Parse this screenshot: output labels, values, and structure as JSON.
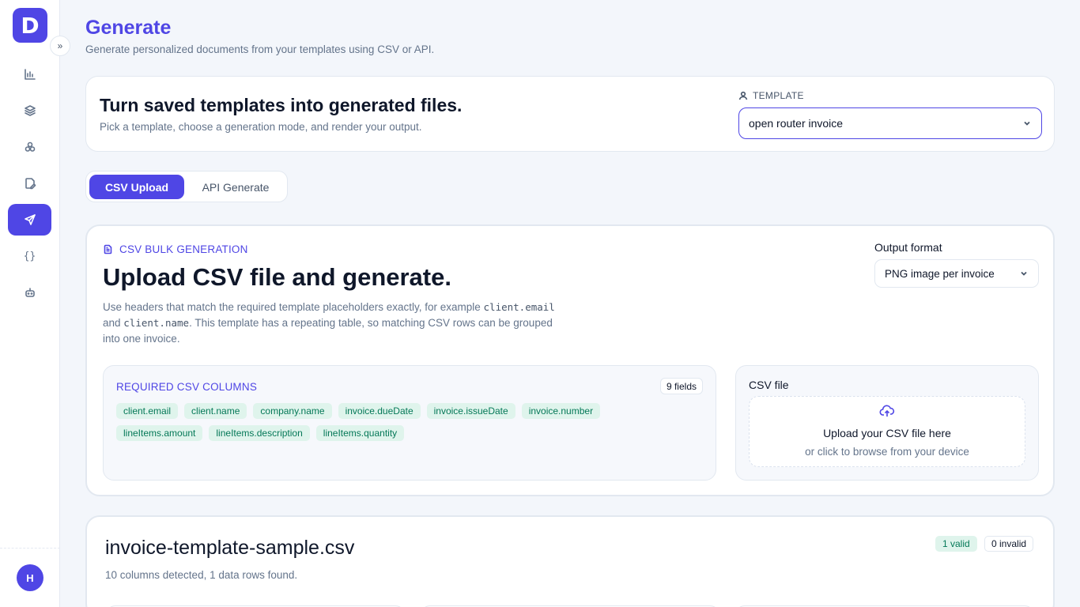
{
  "sidebar": {
    "logo_letter": "D",
    "collapse_icon": "chevrons-right-icon",
    "items": [
      {
        "name": "analytics",
        "icon": "bar-chart-icon"
      },
      {
        "name": "layers",
        "icon": "layers-icon"
      },
      {
        "name": "components",
        "icon": "boxes-icon"
      },
      {
        "name": "editor",
        "icon": "file-edit-icon"
      },
      {
        "name": "generate",
        "icon": "send-icon",
        "active": true
      },
      {
        "name": "api",
        "icon": "braces-icon",
        "glyph": "{}"
      },
      {
        "name": "bot",
        "icon": "bot-icon"
      }
    ],
    "avatar_initial": "H"
  },
  "header": {
    "title": "Generate",
    "subtitle": "Generate personalized documents from your templates using CSV or API."
  },
  "template_card": {
    "heading": "Turn saved templates into generated files.",
    "subheading": "Pick a template, choose a generation mode, and render your output.",
    "label": "TEMPLATE",
    "selected": "open router invoice"
  },
  "tabs": [
    {
      "label": "CSV Upload",
      "active": true
    },
    {
      "label": "API Generate",
      "active": false
    }
  ],
  "csv_card": {
    "kicker": "CSV BULK GENERATION",
    "heading": "Upload CSV file and generate.",
    "desc_1": "Use headers that match the required template placeholders exactly, for example ",
    "code_1": "client.email",
    "desc_2": " and ",
    "code_2": "client.name",
    "desc_3": ". This template has a repeating table, so matching CSV rows can be grouped into one invoice.",
    "output_label": "Output format",
    "output_selected": "PNG image per invoice",
    "required_title": "REQUIRED CSV COLUMNS",
    "fields_badge": "9 fields",
    "columns": [
      "client.email",
      "client.name",
      "company.name",
      "invoice.dueDate",
      "invoice.issueDate",
      "invoice.number",
      "lineItems.amount",
      "lineItems.description",
      "lineItems.quantity"
    ],
    "file_label": "CSV file",
    "drop_title": "Upload your CSV file here",
    "drop_sub": "or click to browse from your device"
  },
  "result_card": {
    "filename": "invoice-template-sample.csv",
    "summary": "10 columns detected, 1 data rows found.",
    "valid_badge": "1 valid",
    "invalid_badge": "0 invalid"
  },
  "colors": {
    "accent": "#4f46e5",
    "chip_bg": "#dff4ec",
    "chip_text": "#047857"
  }
}
